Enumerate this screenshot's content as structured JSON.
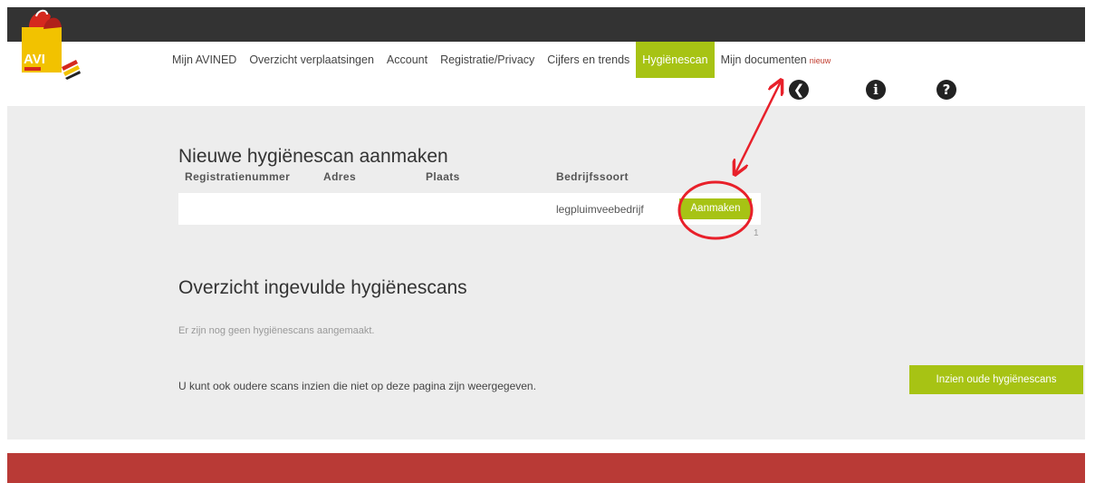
{
  "logo": {
    "text": "AVI"
  },
  "nav": {
    "items": [
      {
        "label": "Mijn AVINED"
      },
      {
        "label": "Overzicht verplaatsingen"
      },
      {
        "label": "Account"
      },
      {
        "label": "Registratie/Privacy"
      },
      {
        "label": "Cijfers en trends"
      },
      {
        "label": "Hygiënescan",
        "active": true
      },
      {
        "label": "Mijn documenten"
      }
    ],
    "new_badge": "nieuw"
  },
  "icons": [
    "back-arrow-icon",
    "info-icon",
    "help-icon"
  ],
  "create_section": {
    "title": "Nieuwe hygiënescan aanmaken",
    "columns": [
      "Registratienummer",
      "Adres",
      "Plaats",
      "Bedrijfssoort"
    ],
    "row": {
      "registratienummer": "",
      "adres": "",
      "plaats": "",
      "bedrijfssoort": "legpluimveebedrijf",
      "button_label": "Aanmaken"
    },
    "pager": "1"
  },
  "overview_section": {
    "title": "Overzicht ingevulde hygiënescans",
    "empty_text": "Er zijn nog geen hygiënescans aangemaakt.",
    "old_scans_text": "U kunt ook oudere scans inzien die niet op deze pagina zijn weergegeven.",
    "old_scans_button": "Inzien oude hygiënescans"
  },
  "colors": {
    "topbar": "#333333",
    "accent": "#a7c314",
    "footer": "#b93a36",
    "content_bg": "#ededed",
    "annotation": "#e8202a"
  }
}
